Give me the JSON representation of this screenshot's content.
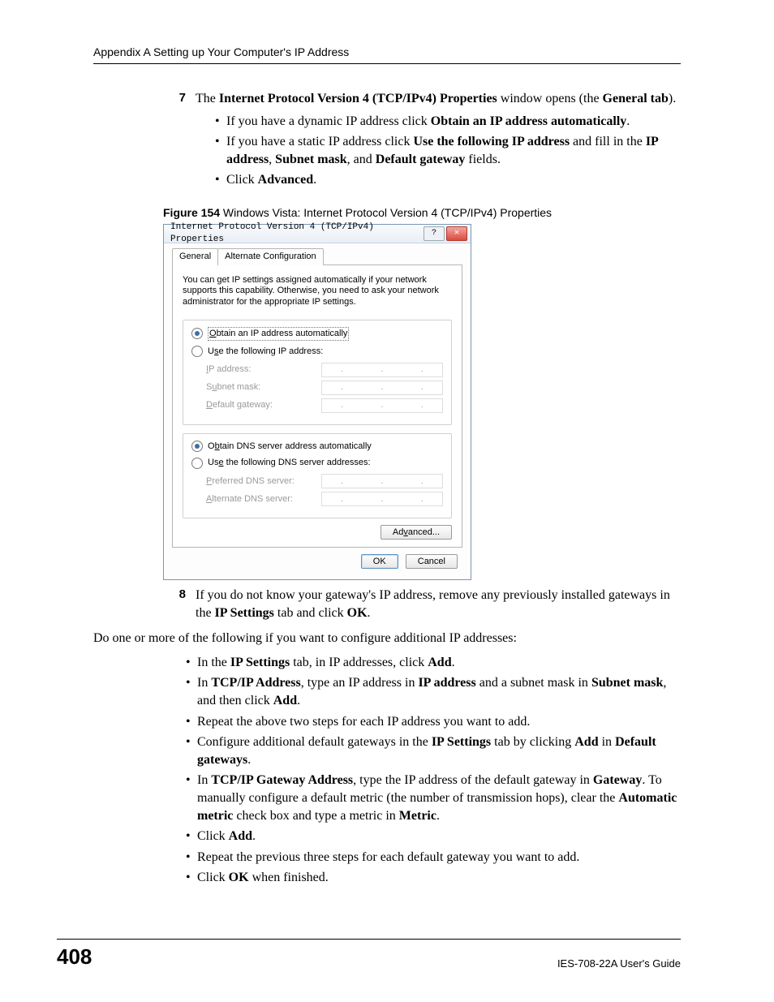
{
  "header": {
    "title": "Appendix A Setting up Your Computer's IP Address"
  },
  "step7": {
    "num": "7",
    "intro_parts": [
      "The ",
      "Internet Protocol Version 4 (TCP/IPv4) Properties",
      " window opens (the ",
      "General tab",
      ")."
    ],
    "b1": [
      "If you have a dynamic IP address click ",
      "Obtain an IP address automatically",
      "."
    ],
    "b2": [
      "If you have a static IP address click ",
      "Use the following IP address",
      " and fill in the ",
      "IP address",
      ", ",
      "Subnet mask",
      ", and ",
      "Default gateway",
      " fields."
    ],
    "b3": [
      "Click ",
      "Advanced",
      "."
    ]
  },
  "figure": {
    "label": "Figure 154",
    "caption": "   Windows Vista: Internet Protocol Version 4 (TCP/IPv4) Properties"
  },
  "dialog": {
    "title": "Internet Protocol Version 4 (TCP/IPv4) Properties",
    "tabs": {
      "general": "General",
      "alt": "Alternate Configuration"
    },
    "desc": "You can get IP settings assigned automatically if your network supports this capability. Otherwise, you need to ask your network administrator for the appropriate IP settings.",
    "ip_group": {
      "auto": "Obtain an IP address automatically",
      "manual": "Use the following IP address:",
      "ip_label": "IP address:",
      "subnet_label": "Subnet mask:",
      "gateway_label": "Default gateway:"
    },
    "dns_group": {
      "auto": "Obtain DNS server address automatically",
      "manual": "Use the following DNS server addresses:",
      "pref_label": "Preferred DNS server:",
      "alt_label": "Alternate DNS server:"
    },
    "advanced_btn": "Advanced...",
    "ok_btn": "OK",
    "cancel_btn": "Cancel"
  },
  "step8": {
    "num": "8",
    "text": [
      " If you do not know your gateway's IP address, remove any previously installed gateways in the ",
      "IP Settings",
      " tab and click ",
      "OK",
      "."
    ]
  },
  "after": "Do one or more of the following if you want to configure additional IP addresses:",
  "bullets2": {
    "a": [
      "In the ",
      "IP Settings",
      " tab, in IP addresses, click ",
      "Add",
      "."
    ],
    "b": [
      "In ",
      "TCP/IP Address",
      ", type an IP address in ",
      "IP address",
      " and a subnet mask in ",
      "Subnet mask",
      ", and then click ",
      "Add",
      "."
    ],
    "c": "Repeat the above two steps for each IP address you want to add.",
    "d": [
      "Configure additional default gateways in the ",
      "IP Settings",
      " tab by clicking ",
      "Add",
      " in ",
      "Default gateways",
      "."
    ],
    "e": [
      "In ",
      "TCP/IP Gateway Address",
      ", type the IP address of the default gateway in ",
      "Gateway",
      ". To manually configure a default metric (the number of transmission hops), clear the ",
      "Automatic metric",
      " check box and type a metric in ",
      "Metric",
      "."
    ],
    "f": [
      "Click ",
      "Add",
      "."
    ],
    "g": "Repeat the previous three steps for each default gateway you want to add.",
    "h": [
      "Click ",
      "OK",
      " when finished."
    ]
  },
  "footer": {
    "page": "408",
    "guide": "IES-708-22A User's Guide"
  }
}
